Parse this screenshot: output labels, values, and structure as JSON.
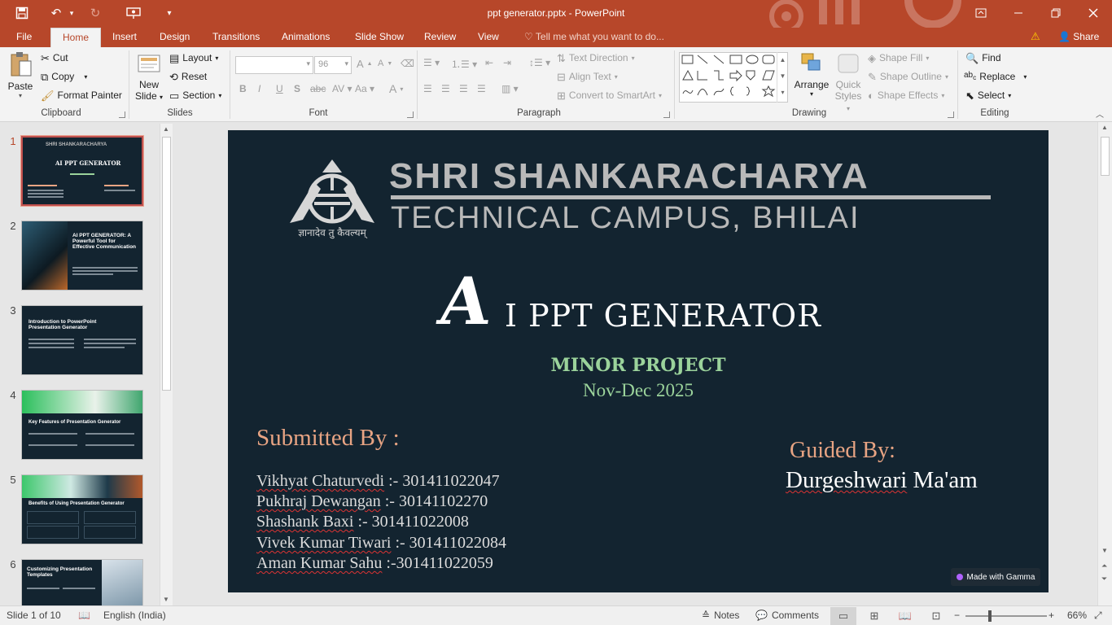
{
  "window": {
    "title": "ppt generator.pptx - PowerPoint",
    "minimize_icon": "minimize-icon",
    "maximize_icon": "restore-icon",
    "close_icon": "close-icon"
  },
  "tabs": {
    "file": "File",
    "home": "Home",
    "insert": "Insert",
    "design": "Design",
    "transitions": "Transitions",
    "animations": "Animations",
    "slide_show": "Slide Show",
    "review": "Review",
    "view": "View",
    "tell_me": "Tell me what you want to do...",
    "share": "Share"
  },
  "ribbon": {
    "clipboard": {
      "label": "Clipboard",
      "paste": "Paste",
      "cut": "Cut",
      "copy": "Copy",
      "format_painter": "Format Painter"
    },
    "slides": {
      "label": "Slides",
      "new_slide_1": "New",
      "new_slide_2": "Slide",
      "layout": "Layout",
      "reset": "Reset",
      "section": "Section"
    },
    "font": {
      "label": "Font",
      "font_name": "",
      "font_size": "96"
    },
    "paragraph": {
      "label": "Paragraph",
      "text_direction": "Text Direction",
      "align_text": "Align Text",
      "convert_smartart": "Convert to SmartArt"
    },
    "drawing": {
      "label": "Drawing",
      "arrange": "Arrange",
      "quick_styles_1": "Quick",
      "quick_styles_2": "Styles",
      "shape_fill": "Shape Fill",
      "shape_outline": "Shape Outline",
      "shape_effects": "Shape Effects"
    },
    "editing": {
      "label": "Editing",
      "find": "Find",
      "replace": "Replace",
      "select": "Select"
    }
  },
  "thumbnails": [
    {
      "num": "1",
      "title": "AI PPT GENERATOR"
    },
    {
      "num": "2",
      "title": "AI PPT GENERATOR: A Powerful Tool for Effective Communication"
    },
    {
      "num": "3",
      "title": "Introduction to PowerPoint Presentation Generator"
    },
    {
      "num": "4",
      "title": "Key Features of Presentation Generator"
    },
    {
      "num": "5",
      "title": "Benefits of Using Presentation Generator"
    },
    {
      "num": "6",
      "title": "Customizing Presentation Templates"
    }
  ],
  "slide": {
    "logo_text": "ज्ञानादेव तु कैवल्यम्",
    "school_line1": "SHRI SHANKARACHARYA",
    "school_line2": "TECHNICAL CAMPUS, BHILAI",
    "title_initial": "A",
    "title_rest": "I PPT GENERATOR",
    "subtitle": "MINOR PROJECT",
    "dates": "Nov-Dec 2025",
    "submitted_heading": "Submitted By :",
    "members": [
      {
        "name": "Vikhyat Chaturvedi",
        "id": " :- 301411022047"
      },
      {
        "name": "Pukhraj Dewangan",
        "id": " :- 30141102270"
      },
      {
        "name": "Shashank Baxi",
        "id": " :- 301411022008"
      },
      {
        "name": "Vivek Kumar Tiwari",
        "id": " :- 301411022084"
      },
      {
        "name": "Aman Kumar Sahu",
        "id": " :-301411022059"
      }
    ],
    "guided_heading": "Guided By:",
    "guide_first": "Durgeshwari",
    "guide_rest": " Ma'am",
    "badge": "Made with Gamma"
  },
  "status": {
    "slide_info": "Slide 1 of 10",
    "language": "English (India)",
    "notes": "Notes",
    "comments": "Comments",
    "zoom": "66%"
  },
  "colors": {
    "accent": "#b7472a",
    "slide_bg": "#132430",
    "heading_peach": "#e8a483",
    "subtitle_green": "#9bd39b"
  }
}
